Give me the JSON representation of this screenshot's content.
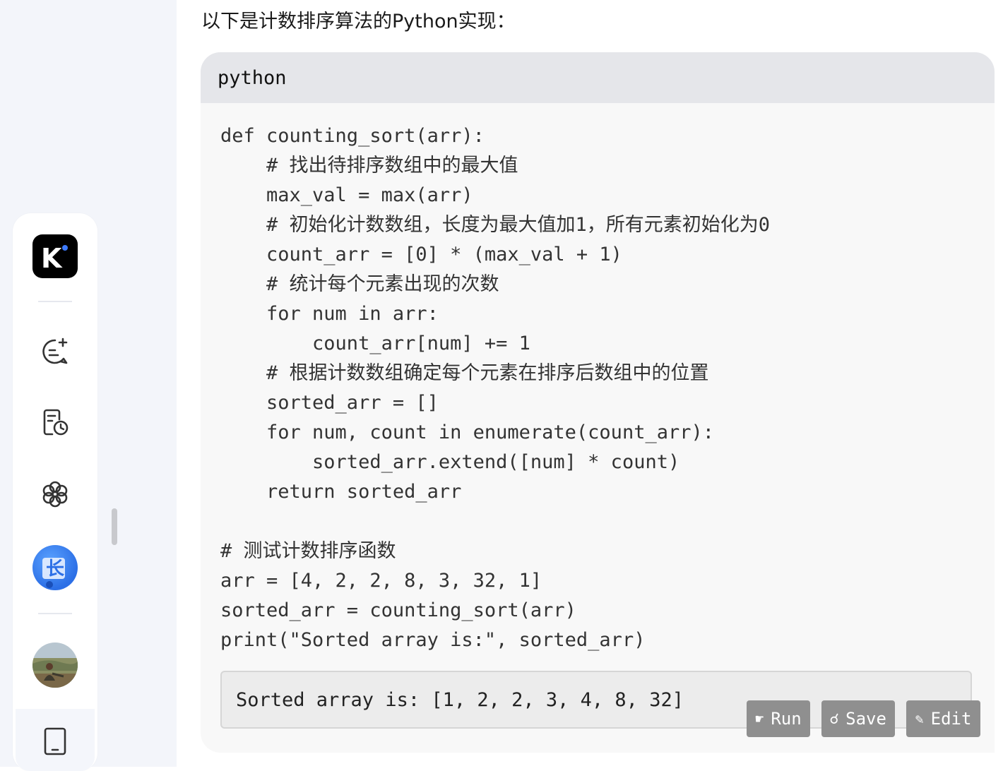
{
  "intro": {
    "text": "以下是计数排序算法的Python实现："
  },
  "code": {
    "language": "python",
    "lines": [
      "def counting_sort(arr):",
      "    # 找出待排序数组中的最大值",
      "    max_val = max(arr)",
      "    # 初始化计数数组，长度为最大值加1，所有元素初始化为0",
      "    count_arr = [0] * (max_val + 1)",
      "    # 统计每个元素出现的次数",
      "    for num in arr:",
      "        count_arr[num] += 1",
      "    # 根据计数数组确定每个元素在排序后数组中的位置",
      "    sorted_arr = []",
      "    for num, count in enumerate(count_arr):",
      "        sorted_arr.extend([num] * count)",
      "    return sorted_arr",
      "",
      "# 测试计数排序函数",
      "arr = [4, 2, 2, 8, 3, 32, 1]",
      "sorted_arr = counting_sort(arr)",
      "print(\"Sorted array is:\", sorted_arr)"
    ],
    "output": "Sorted array is: [1, 2, 2, 3, 4, 8, 32]"
  },
  "actions": {
    "run": {
      "label": "Run",
      "icon": "☛"
    },
    "save": {
      "label": "Save",
      "icon": "☌"
    },
    "edit": {
      "label": "Edit",
      "icon": "✎"
    }
  },
  "sidebar": {
    "logo_letter": "K",
    "bot_char": "长",
    "items": [
      "app-logo",
      "new-chat-icon",
      "history-icon",
      "discover-icon",
      "assistant-avatar",
      "user-avatar",
      "tablet-icon"
    ]
  },
  "colors": {
    "accent_blue": "#2c6fe6",
    "code_header_bg": "#e5e6ea",
    "code_bg": "#f8f8f8",
    "button_bg": "#8f8f8f"
  }
}
